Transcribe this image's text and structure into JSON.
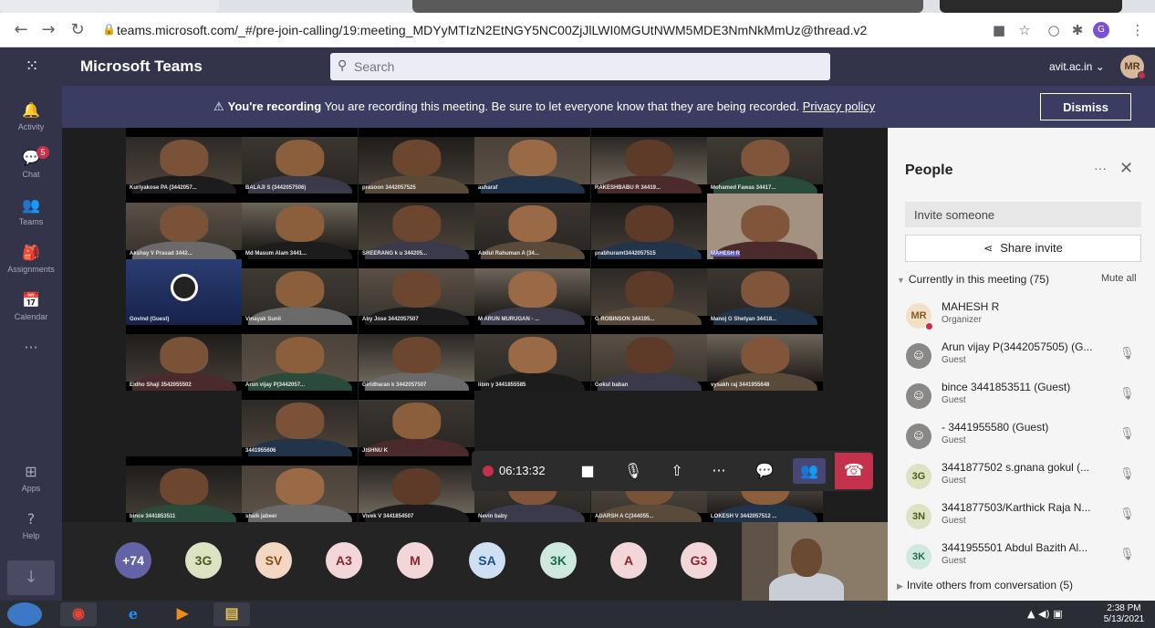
{
  "browser": {
    "url": "teams.microsoft.com/_#/pre-join-calling/19:meeting_MDYyMTIzN2EtNGY5NC00ZjJlLWI0MGUtNWM5MDE3NmNkMmUz@thread.v2"
  },
  "header": {
    "app_title": "Microsoft Teams",
    "search_placeholder": "Search",
    "tenant": "avit.ac.in",
    "user_initials": "MR"
  },
  "rail": {
    "items": [
      {
        "label": "Activity"
      },
      {
        "label": "Chat",
        "badge": "5"
      },
      {
        "label": "Teams"
      },
      {
        "label": "Assignments"
      },
      {
        "label": "Calendar"
      },
      {
        "label": "···"
      },
      {
        "label": "Apps"
      },
      {
        "label": "Help"
      }
    ]
  },
  "banner": {
    "bold": "You're recording",
    "message": " You are recording this meeting. Be sure to let everyone know that they are being recorded. ",
    "link": "Privacy policy",
    "dismiss": "Dismiss"
  },
  "call": {
    "timer": "06:13:32"
  },
  "tiles": [
    {
      "name": "Kuriyakose PA (3442057..."
    },
    {
      "name": "BALAJI S (3442057506)"
    },
    {
      "name": "prasoon 3442057525"
    },
    {
      "name": "asharaf"
    },
    {
      "name": "RAKESHBABU R 34419..."
    },
    {
      "name": "Mohamed Fawas 34417..."
    },
    {
      "name": "Akshay V Prasad 3442..."
    },
    {
      "name": "Md Masum Alam 3441..."
    },
    {
      "name": "SREERANG k u 344205..."
    },
    {
      "name": "Abdul Rahuman A (34..."
    },
    {
      "name": "prabhuramt3442057515"
    },
    {
      "name": "MAHESH R"
    },
    {
      "name": "Govind (Guest)"
    },
    {
      "name": "Vinayak Sunil"
    },
    {
      "name": "Aby Jose 3442057507"
    },
    {
      "name": "M ARUN MURUGAN - ..."
    },
    {
      "name": "G ROBINSON 344195..."
    },
    {
      "name": "Manoj G Shetyan 34418..."
    },
    {
      "name": "Eldho Shaji 3542055502"
    },
    {
      "name": "Arun vijay P(3442057..."
    },
    {
      "name": "Giridharan k 3442057507"
    },
    {
      "name": "libin y 3441855585"
    },
    {
      "name": "Gokul baban"
    },
    {
      "name": "vysakh raj 3441955648"
    },
    {
      "name": "3441955606"
    },
    {
      "name": "JISHNU K"
    },
    {
      "name": "bince 3441853511"
    },
    {
      "name": "shaik jabeer"
    },
    {
      "name": "Vivek V 3441854507"
    },
    {
      "name": "Nevin baby"
    },
    {
      "name": "ADARSH A C(344055..."
    },
    {
      "name": "LOKESH V 3442057512 ..."
    }
  ],
  "avatar_row": [
    {
      "initials": "+74",
      "bg": "#6264a7",
      "fg": "#ffffff"
    },
    {
      "initials": "3G",
      "bg": "#dce3c2",
      "fg": "#4b5a1c"
    },
    {
      "initials": "SV",
      "bg": "#f2d8c2",
      "fg": "#8a4a16"
    },
    {
      "initials": "A3",
      "bg": "#f3d6d8",
      "fg": "#8a2630"
    },
    {
      "initials": "M",
      "bg": "#f3d6d8",
      "fg": "#8a2630"
    },
    {
      "initials": "SA",
      "bg": "#cfe0f3",
      "fg": "#1b4f8a"
    },
    {
      "initials": "3K",
      "bg": "#cfe9df",
      "fg": "#1d6b4d"
    },
    {
      "initials": "A",
      "bg": "#f3d6d8",
      "fg": "#8a2630"
    },
    {
      "initials": "G3",
      "bg": "#f3d6d8",
      "fg": "#8a2630"
    }
  ],
  "people": {
    "title": "People",
    "more": "···",
    "invite_placeholder": "Invite someone",
    "share_invite": "Share invite",
    "in_meeting": "Currently in this meeting (75)",
    "mute_all": "Mute all",
    "invite_others": "Invite others from conversation (5)",
    "list": [
      {
        "initials": "MR",
        "name": "MAHESH R",
        "role": "Organizer",
        "bg": "#f2e1c9",
        "fg": "#8a5a1c",
        "mic": false
      },
      {
        "initials": "",
        "name": "Arun vijay P(3442057505) (G...",
        "role": "Guest",
        "bg": "#8a8886",
        "fg": "#ffffff",
        "mic": true
      },
      {
        "initials": "",
        "name": "bince 3441853511 (Guest)",
        "role": "Guest",
        "bg": "#8a8886",
        "fg": "#ffffff",
        "mic": true
      },
      {
        "initials": "",
        "name": "- 3441955580 (Guest)",
        "role": "Guest",
        "bg": "#8a8886",
        "fg": "#ffffff",
        "mic": true
      },
      {
        "initials": "3G",
        "name": "3441877502 s.gnana gokul (...",
        "role": "Guest",
        "bg": "#dce3c2",
        "fg": "#4b5a1c",
        "mic": true
      },
      {
        "initials": "3N",
        "name": "3441877503/Karthick Raja N...",
        "role": "Guest",
        "bg": "#dce3c2",
        "fg": "#4b5a1c",
        "mic": true
      },
      {
        "initials": "3K",
        "name": "3441955501 Abdul Bazith Al...",
        "role": "Guest",
        "bg": "#cfe9df",
        "fg": "#1d6b4d",
        "mic": true
      }
    ]
  },
  "taskbar": {
    "time": "2:38 PM",
    "date": "5/13/2021"
  }
}
